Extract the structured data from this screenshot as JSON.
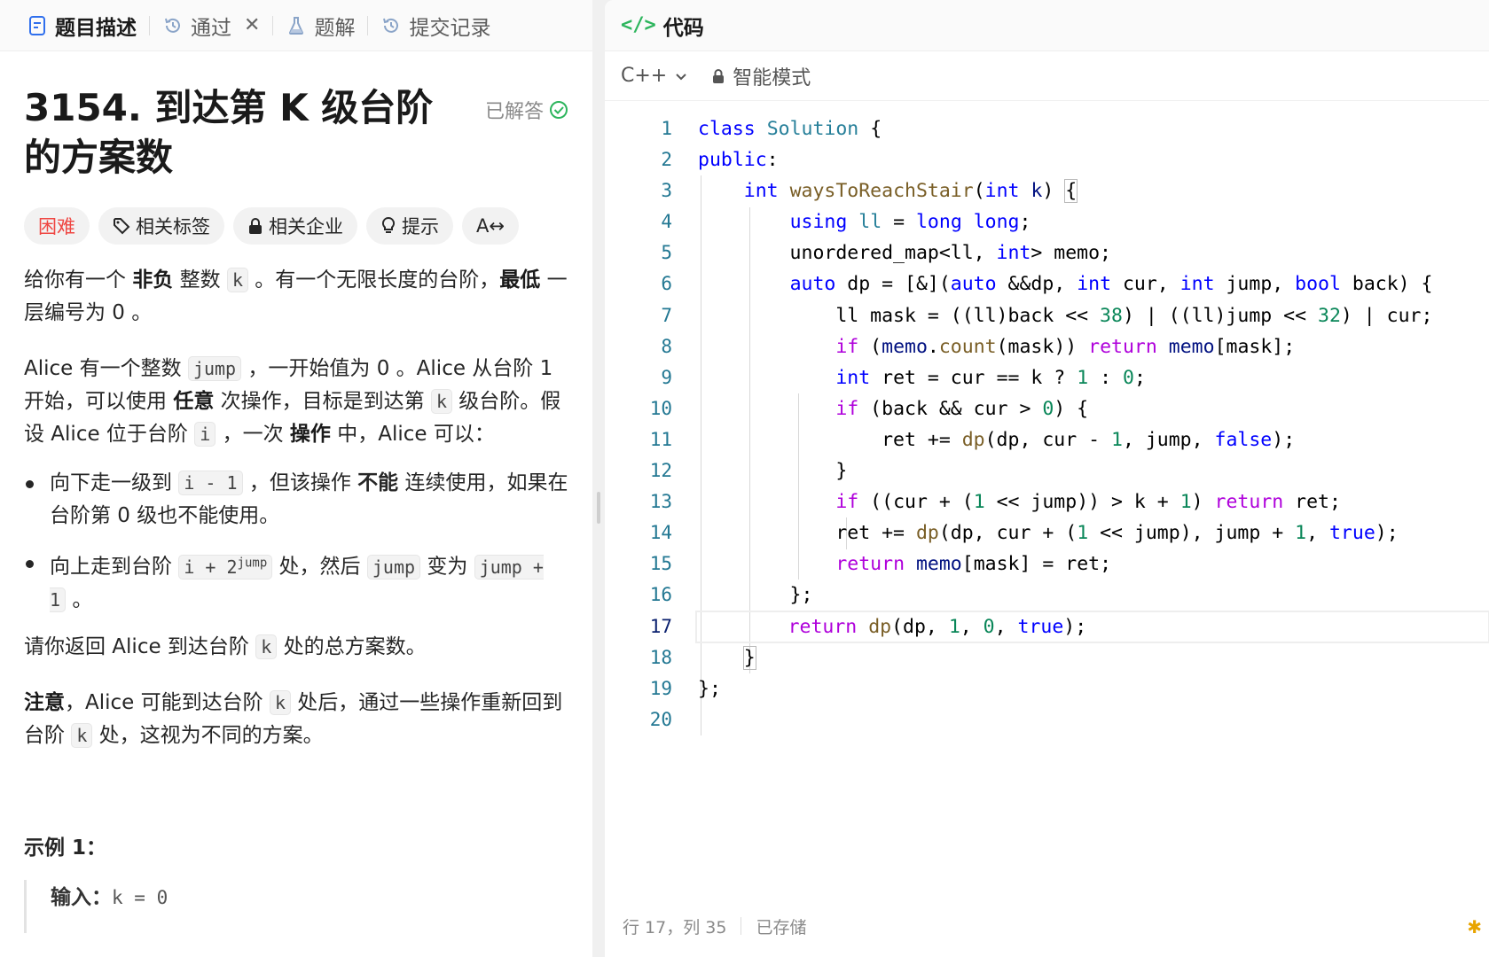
{
  "left_tabs": [
    {
      "label": "题目描述",
      "icon": "document-icon"
    },
    {
      "label": "通过",
      "icon": "history-icon"
    },
    {
      "label": "题解",
      "icon": "flask-icon"
    },
    {
      "label": "提交记录",
      "icon": "history-icon"
    }
  ],
  "problem": {
    "title": "3154. 到达第 K 级台阶的方案数",
    "status": "已解答",
    "tags": {
      "difficulty": "困难",
      "related_tags": "相关标签",
      "related_companies": "相关企业",
      "hint": "提示",
      "translate": "A↔"
    },
    "p1": {
      "a": "给你有一个 ",
      "b": "非负",
      "c": " 整数 ",
      "code": "k",
      "d": " 。有一个无限长度的台阶，",
      "e": "最低",
      "f": " 一层编号为 0 。"
    },
    "p2": {
      "a": "Alice 有一个整数 ",
      "code1": "jump",
      "b": " ，一开始值为 0 。Alice 从台阶 1 开始，可以使用 ",
      "c": "任意",
      "d": " 次操作，目标是到达第 ",
      "code2": "k",
      "e": " 级台阶。假设 Alice 位于台阶 ",
      "code3": "i",
      "f": " ，一次 ",
      "g": "操作",
      "h": " 中，Alice 可以："
    },
    "b1": {
      "a": "向下走一级到 ",
      "code": "i - 1",
      "b": " ，但该操作 ",
      "c": "不能",
      "d": " 连续使用，如果在台阶第 0 级也不能使用。"
    },
    "b2": {
      "a": "向上走到台阶 ",
      "code_base": "i + 2",
      "code_sup": "jump",
      "b": " 处，然后 ",
      "code2": "jump",
      "c": " 变为 ",
      "code3": "jump + 1",
      "d": " 。"
    },
    "p3": {
      "a": "请你返回 Alice 到达台阶 ",
      "code": "k",
      "b": " 处的总方案数。"
    },
    "p4": {
      "a": "注意",
      "b": "，Alice 可能到达台阶 ",
      "code": "k",
      "c": " 处后，通过一些操作重新回到台阶 ",
      "code2": "k",
      "d": " 处，这视为不同的方案。"
    },
    "example_title": "示例 1：",
    "example_input_label": "输入：",
    "example_input_value": "k = 0"
  },
  "editor": {
    "title": "代码",
    "language": "C++",
    "mode": "智能模式",
    "line_numbers": [
      "1",
      "2",
      "3",
      "4",
      "5",
      "6",
      "7",
      "8",
      "9",
      "10",
      "11",
      "12",
      "13",
      "14",
      "15",
      "16",
      "17",
      "18",
      "19",
      "20"
    ],
    "status_position": "行 17，列 35",
    "status_saved": "已存储"
  }
}
